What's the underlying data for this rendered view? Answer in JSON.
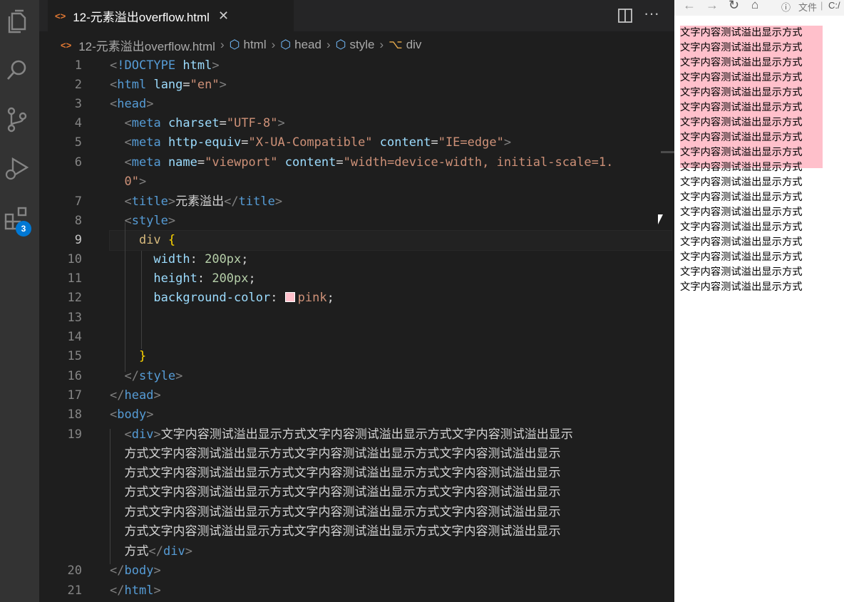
{
  "window": {
    "title": "元素溢出"
  },
  "tab": {
    "label": "12-元素溢出overflow.html",
    "icon": "html-file-icon"
  },
  "breadcrumb": [
    "12-元素溢出overflow.html",
    "html",
    "head",
    "style",
    "div"
  ],
  "activity_bar": {
    "icons": [
      "explorer-icon",
      "search-icon",
      "source-control-icon",
      "run-debug-icon",
      "extensions-icon"
    ],
    "extensions_badge": "3"
  },
  "editor": {
    "line_numbers": [
      "1",
      "2",
      "3",
      "4",
      "5",
      "6",
      "",
      "7",
      "8",
      "9",
      "10",
      "11",
      "12",
      "13",
      "14",
      "15",
      "16",
      "17",
      "18",
      "19",
      "",
      "",
      "",
      "",
      "",
      "",
      "20",
      "21"
    ],
    "current_line": "9"
  },
  "browser": {
    "address_label": "文件",
    "address_path": "C:/",
    "div_lines": [
      "文字内容测试溢出显示方式",
      "文字内容测试溢出显示方式",
      "文字内容测试溢出显示方式",
      "文字内容测试溢出显示方式",
      "文字内容测试溢出显示方式",
      "文字内容测试溢出显示方式",
      "文字内容测试溢出显示方式",
      "文字内容测试溢出显示方式",
      "文字内容测试溢出显示方式",
      "文字内容测试溢出显示方式",
      "文字内容测试溢出显示方式",
      "文字内容测试溢出显示方式",
      "文字内容测试溢出显示方式",
      "文字内容测试溢出显示方式",
      "文字内容测试溢出显示方式",
      "文字内容测试溢出显示方式",
      "文字内容测试溢出显示方式",
      "文字内容测试溢出显示方式"
    ]
  },
  "colors": {
    "editor_bg": "#1e1e1e",
    "activity_bg": "#333333",
    "badge": "#0078d4",
    "pink": "pink"
  }
}
